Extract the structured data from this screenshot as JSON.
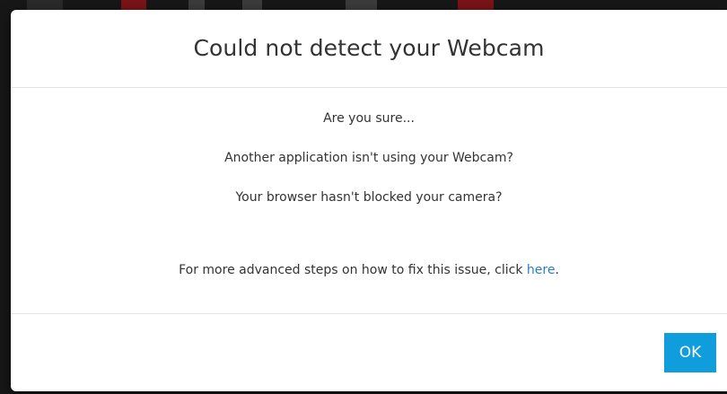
{
  "dialog": {
    "title": "Could not detect your Webcam",
    "lines": [
      "Are you sure...",
      "Another application isn't using your Webcam?",
      "Your browser hasn't blocked your camera?"
    ],
    "help": {
      "prefix": "For more advanced steps on how to fix this issue, click ",
      "link_text": "here",
      "suffix": "."
    },
    "ok_label": "OK"
  },
  "colors": {
    "accent": "#0f9ddc",
    "link": "#2a7ec4",
    "text": "#333333",
    "backdrop": "#171717"
  }
}
